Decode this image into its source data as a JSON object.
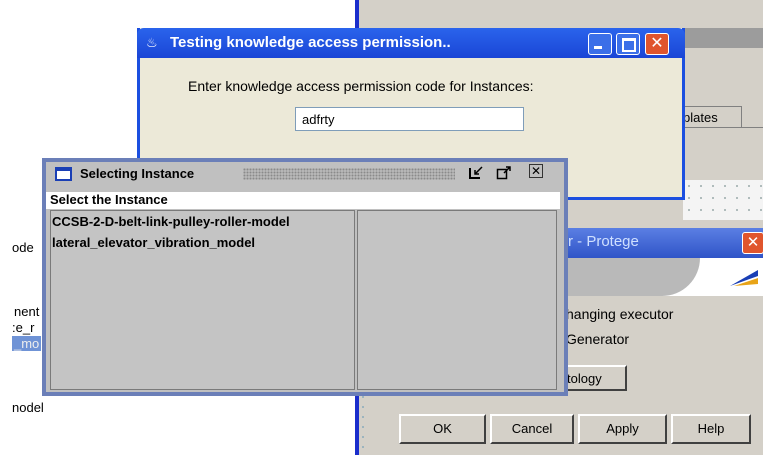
{
  "colors": {
    "xp_title_blue": "#1a45d6",
    "xp_close_red": "#e0552d",
    "window_grey": "#d4d0c8"
  },
  "background": {
    "tab_label": "plates",
    "protege_title": "r - Protege",
    "lines": [
      "hanging executor",
      "Generator"
    ],
    "ontology_button": "tology",
    "buttons": {
      "ok": "OK",
      "cancel": "Cancel",
      "apply": "Apply",
      "help": "Help"
    },
    "close_glyph": "✕",
    "left_fragments": [
      "ode",
      "nent",
      ":e_r",
      "_mo",
      "nodel"
    ]
  },
  "permission_dialog": {
    "title": "Testing knowledge access permission..",
    "prompt": "Enter knowledge access permission code for Instances:",
    "input_value": "adfrty",
    "close_glyph": "✕"
  },
  "instance_dialog": {
    "title": "Selecting Instance",
    "label": "Select the Instance",
    "items": [
      "CCSB-2-D-belt-link-pulley-roller-model",
      "lateral_elevator_vibration_model"
    ],
    "icons": [
      "restore-icon",
      "maximize-icon",
      "close-icon"
    ]
  }
}
